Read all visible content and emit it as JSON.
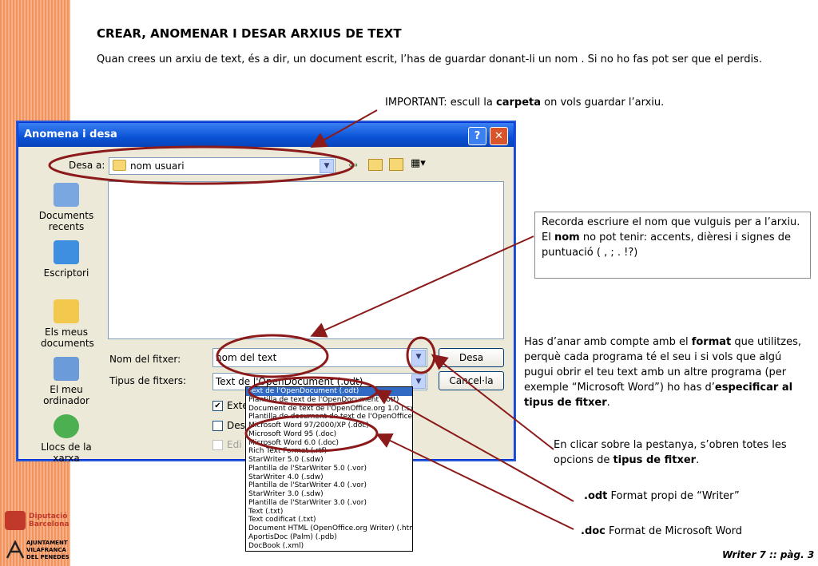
{
  "slide": {
    "title": "CREAR, ANOMENAR I DESAR ARXIUS DE TEXT",
    "intro": "Quan crees un arxiu de text, és a dir, un document escrit, l’has de guardar donant-li un nom . Si no ho fas pot ser que el perdis.",
    "important_label": "IMPORTANT:",
    "important_pre": " escull la ",
    "important_bold": "carpeta",
    "important_post": " on vols guardar l’arxiu.",
    "note_name_1": "Recorda escriure el nom que vulguis per a l’arxiu.",
    "note_name_2_bold": "nom",
    "note_name_2_pre": "El ",
    "note_name_2_post": " no pot tenir: accents, dièresi i signes de puntuació ( , ; . !?)",
    "format_1": "Has d’anar amb compte amb el ",
    "format_bold": "format",
    "format_2": " que utilitzes, perquè cada programa té el seu i si vols que algú pugui obrir el teu text amb un altre programa (per exemple “Microsoft Word”) ho has d’",
    "format_bold2": "especificar al tipus de fitxer",
    "format_3": ".",
    "click_1": "En clicar sobre la pestanya, s’obren totes les opcions de ",
    "click_bold": "tipus de fitxer",
    "click_2": ".",
    "odt_bold": ".odt",
    "odt_text": " Format propi de “Writer”",
    "doc_bold": ".doc",
    "doc_text": " Format de Microsoft Word",
    "footer": "Writer 7 :: pàg. 3",
    "logo_diputacio": [
      "Diputació",
      "Barcelona"
    ],
    "logo_ajuntament": [
      "AJUNTAMENT",
      "VILAFRANCA",
      "DEL PENEDÈS"
    ]
  },
  "dialog": {
    "title": "Anomena i desa",
    "save_in_label": "Desa a:",
    "save_in_value": "nom usuari",
    "places": [
      {
        "label": "Documents recents",
        "icon": "recent-documents-icon",
        "color": "#7aa7e0"
      },
      {
        "label": "Escriptori",
        "icon": "desktop-icon",
        "color": "#3f8fe0"
      },
      {
        "label": "Els meus documents",
        "icon": "my-documents-icon",
        "color": "#f2c94c"
      },
      {
        "label": "El meu ordinador",
        "icon": "my-computer-icon",
        "color": "#6b9bd9"
      },
      {
        "label": "Llocs de la xarxa",
        "icon": "network-places-icon",
        "color": "#4caf50"
      }
    ],
    "filename_label": "Nom del fitxer:",
    "filename_value": "nom del text",
    "filetype_label": "Tipus de fitxers:",
    "filetype_value": "Text de l'OpenDocument (.odt)",
    "save_button": "Desa",
    "cancel_button": "Cancel·la",
    "checkbox_1": "Exte",
    "checkbox_2": "Des",
    "checkbox_3": "Edi",
    "filetype_options": [
      "Text de l'OpenDocument (.odt)",
      "Plantilla de text de l'OpenDocument (.ott)",
      "Document de text de l'OpenOffice.org 1.0 (.sxw)",
      "Plantilla de document de text de l'OpenOffice.org 1.",
      "Microsoft Word 97/2000/XP (.doc)",
      "Microsoft Word 95 (.doc)",
      "Microsoft Word 6.0 (.doc)",
      "Rich Text Format (.rtf)",
      "StarWriter 5.0 (.sdw)",
      "Plantilla de l'StarWriter 5.0 (.vor)",
      "StarWriter 4.0 (.sdw)",
      "Plantilla de l'StarWriter 4.0 (.vor)",
      "StarWriter 3.0 (.sdw)",
      "Plantilla de l'StarWriter 3.0 (.vor)",
      "Text (.txt)",
      "Text codificat (.txt)",
      "Document HTML (OpenOffice.org Writer) (.html)",
      "AportisDoc (Palm) (.pdb)",
      "DocBook (.xml)"
    ],
    "selected_index": 0
  },
  "colors": {
    "annotation": "#8b1a1a",
    "titlebar": "#0a53d6",
    "stripe": "#f0935c"
  }
}
